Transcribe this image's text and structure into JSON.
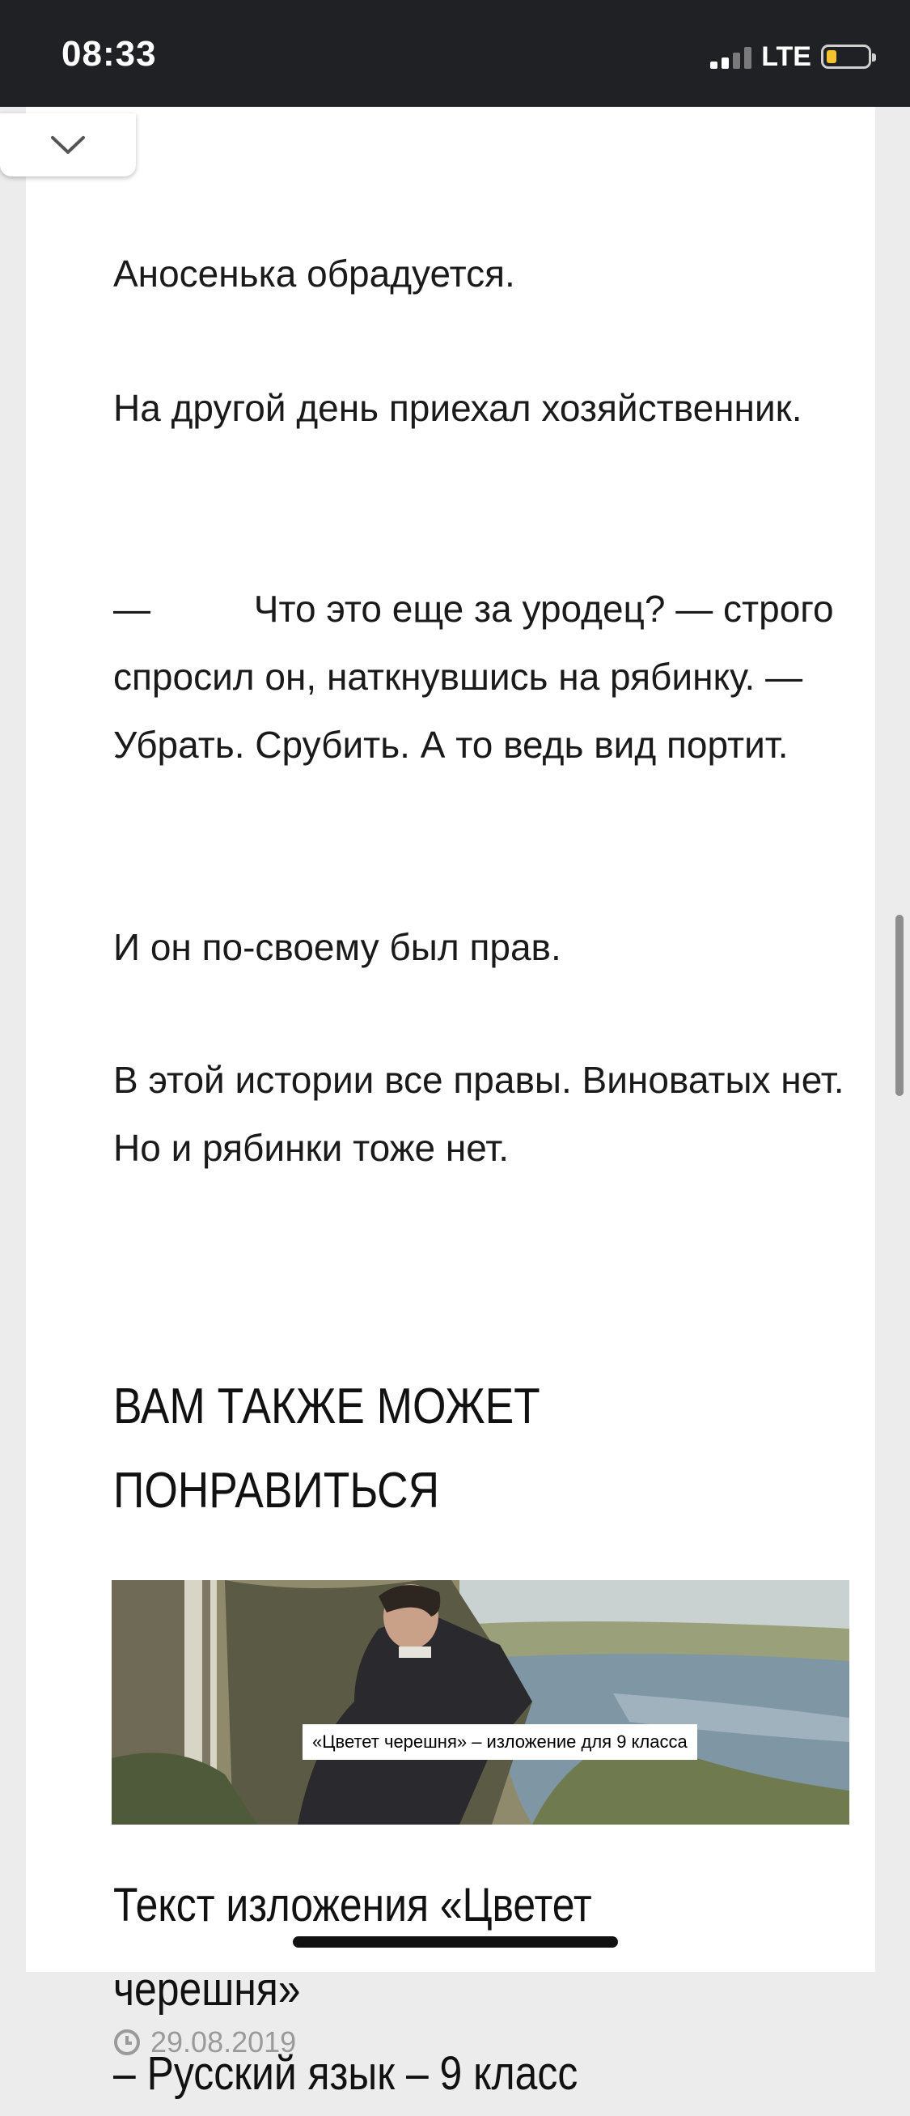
{
  "status_bar": {
    "time": "08:33",
    "network": "LTE",
    "signal_bars_active": 2,
    "signal_bars_total": 4,
    "battery_level": 0.2,
    "battery_color": "#f4c430"
  },
  "article": {
    "paragraphs": [
      "Аносенька обрадуется.",
      "На другой день приехал хозяйственник.",
      "—          Что это еще за уродец? — строго спросил он, наткнувшись на рябинку. — Убрать. Срубить. А то ведь вид портит.",
      "И он по-своему был прав.",
      "В этой истории все правы. Виноватых нет. Но и рябинки тоже нет."
    ]
  },
  "related": {
    "heading_line1": "ВАМ ТАКЖЕ МОЖЕТ",
    "heading_line2": "ПОНРАВИТЬСЯ",
    "item": {
      "image_caption": "«Цветет черешня» – изложение для 9 класса",
      "title_line1": "Текст изложения «Цветет черешня»",
      "title_line2": "– Русский язык – 9 класс",
      "date": "29.08.2019"
    }
  },
  "icons": {
    "collapse": "chevron-down-icon",
    "date": "clock-icon"
  }
}
